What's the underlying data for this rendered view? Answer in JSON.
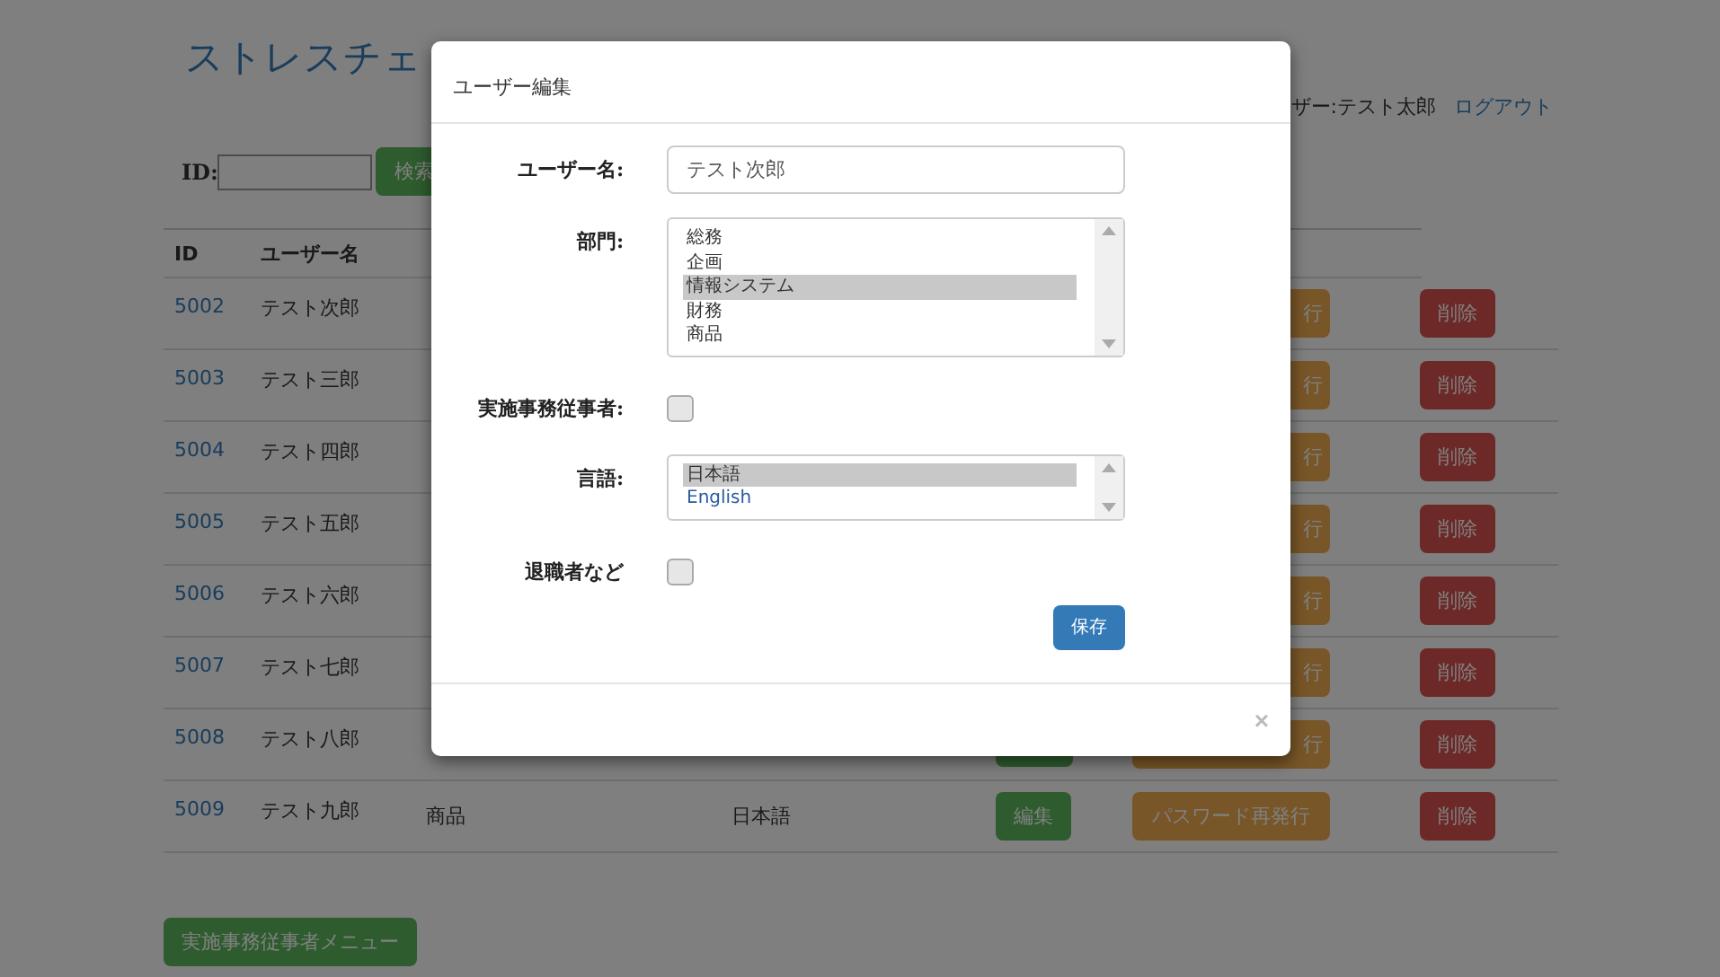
{
  "page": {
    "title": "ストレスチェ",
    "user_label": "ザー:テスト太郎",
    "logout": "ログアウト"
  },
  "search": {
    "label": "ID:",
    "button": "検索"
  },
  "table": {
    "columns": [
      "ID",
      "ユーザー名"
    ],
    "rows": [
      {
        "id": "5002",
        "name": "テスト次郎",
        "pw_label": "行",
        "delete": "削除"
      },
      {
        "id": "5003",
        "name": "テスト三郎",
        "pw_label": "行",
        "delete": "削除"
      },
      {
        "id": "5004",
        "name": "テスト四郎",
        "pw_label": "行",
        "delete": "削除"
      },
      {
        "id": "5005",
        "name": "テスト五郎",
        "pw_label": "行",
        "delete": "削除"
      },
      {
        "id": "5006",
        "name": "テスト六郎",
        "pw_label": "行",
        "delete": "削除"
      },
      {
        "id": "5007",
        "name": "テスト七郎",
        "pw_label": "行",
        "delete": "削除"
      },
      {
        "id": "5008",
        "name": "テスト八郎",
        "pw_label": "行",
        "delete": "削除"
      },
      {
        "id": "5009",
        "name": "テスト九郎",
        "department": "商品",
        "language": "日本語",
        "edit": "編集",
        "pw_label": "パスワード再発行",
        "delete": "削除"
      }
    ]
  },
  "menu_button": "実施事務従事者メニュー",
  "modal": {
    "title": "ユーザー編集",
    "fields": [
      {
        "kind": "text",
        "label": "ユーザー名:",
        "value": "テスト次郎"
      },
      {
        "kind": "list",
        "label": "部門:",
        "options": [
          {
            "label": "総務",
            "selected": false
          },
          {
            "label": "企画",
            "selected": false
          },
          {
            "label": "情報システム",
            "selected": true
          },
          {
            "label": "財務",
            "selected": false
          },
          {
            "label": "商品",
            "selected": false
          }
        ]
      },
      {
        "kind": "checkbox",
        "label": "実施事務従事者:",
        "checked": false
      },
      {
        "kind": "list",
        "label": "言語:",
        "options": [
          {
            "label": "日本語",
            "selected": true
          },
          {
            "label": "English",
            "selected": false
          }
        ]
      },
      {
        "kind": "checkbox",
        "label": "退職者など",
        "checked": false
      }
    ],
    "save": "保存",
    "close": "×"
  }
}
